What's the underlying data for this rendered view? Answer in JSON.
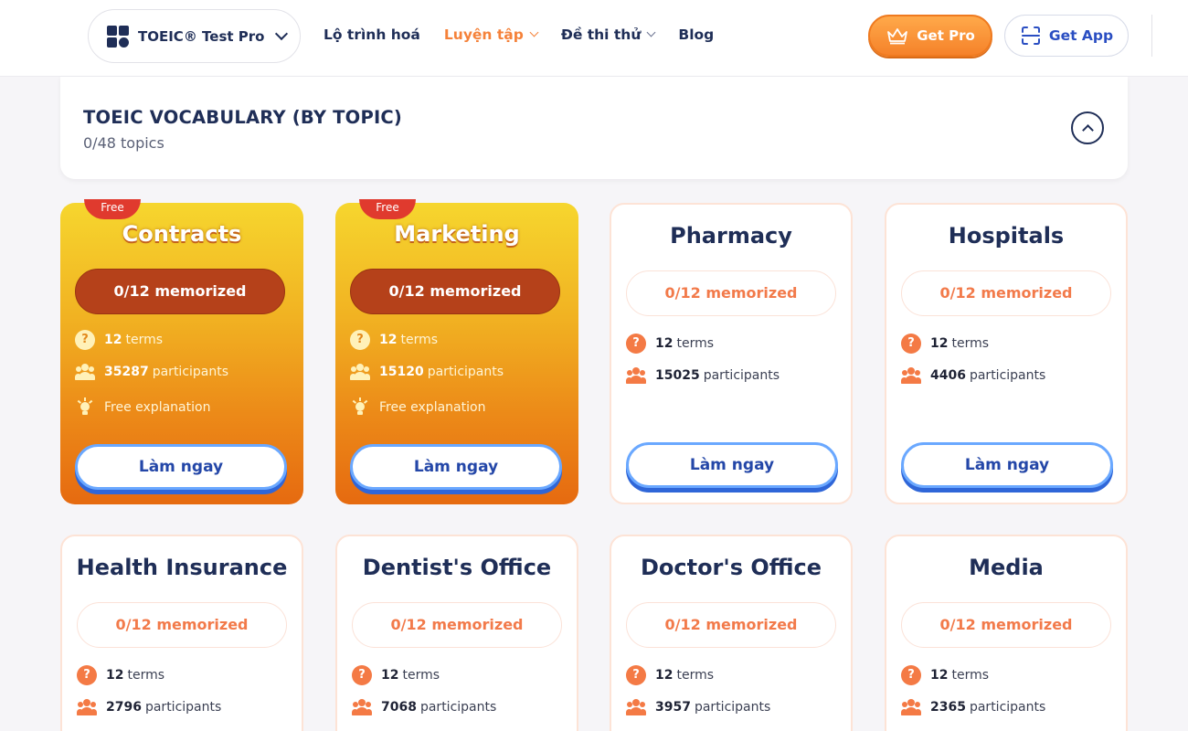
{
  "header": {
    "app_name": "TOEIC® Test Pro",
    "nav": [
      {
        "label": "Lộ trình hoá",
        "active": false,
        "dropdown": false
      },
      {
        "label": "Luyện tập",
        "active": true,
        "dropdown": true
      },
      {
        "label": "Đề thi thử",
        "active": false,
        "dropdown": true
      },
      {
        "label": "Blog",
        "active": false,
        "dropdown": false
      }
    ],
    "get_pro_label": "Get Pro",
    "get_app_label": "Get App"
  },
  "section": {
    "title": "TOEIC VOCABULARY (BY TOPIC)",
    "subtitle": "0/48 topics"
  },
  "labels": {
    "free_badge": "Free",
    "terms_suffix": "terms",
    "participants_suffix": "participants",
    "free_explanation": "Free explanation",
    "start_button": "Làm ngay"
  },
  "cards": [
    {
      "title": "Contracts",
      "memorized": "0/12 memorized",
      "terms": "12",
      "participants": "35287",
      "free": true
    },
    {
      "title": "Marketing",
      "memorized": "0/12 memorized",
      "terms": "12",
      "participants": "15120",
      "free": true
    },
    {
      "title": "Pharmacy",
      "memorized": "0/12 memorized",
      "terms": "12",
      "participants": "15025",
      "free": false
    },
    {
      "title": "Hospitals",
      "memorized": "0/12 memorized",
      "terms": "12",
      "participants": "4406",
      "free": false
    },
    {
      "title": "Health Insurance",
      "memorized": "0/12 memorized",
      "terms": "12",
      "participants": "2796",
      "free": false
    },
    {
      "title": "Dentist's Office",
      "memorized": "0/12 memorized",
      "terms": "12",
      "participants": "7068",
      "free": false
    },
    {
      "title": "Doctor's Office",
      "memorized": "0/12 memorized",
      "terms": "12",
      "participants": "3957",
      "free": false
    },
    {
      "title": "Media",
      "memorized": "0/12 memorized",
      "terms": "12",
      "participants": "2365",
      "free": false
    }
  ],
  "colors": {
    "brand_navy": "#1f2e57",
    "accent_orange": "#f5823a",
    "link_blue": "#2a4ec2"
  }
}
